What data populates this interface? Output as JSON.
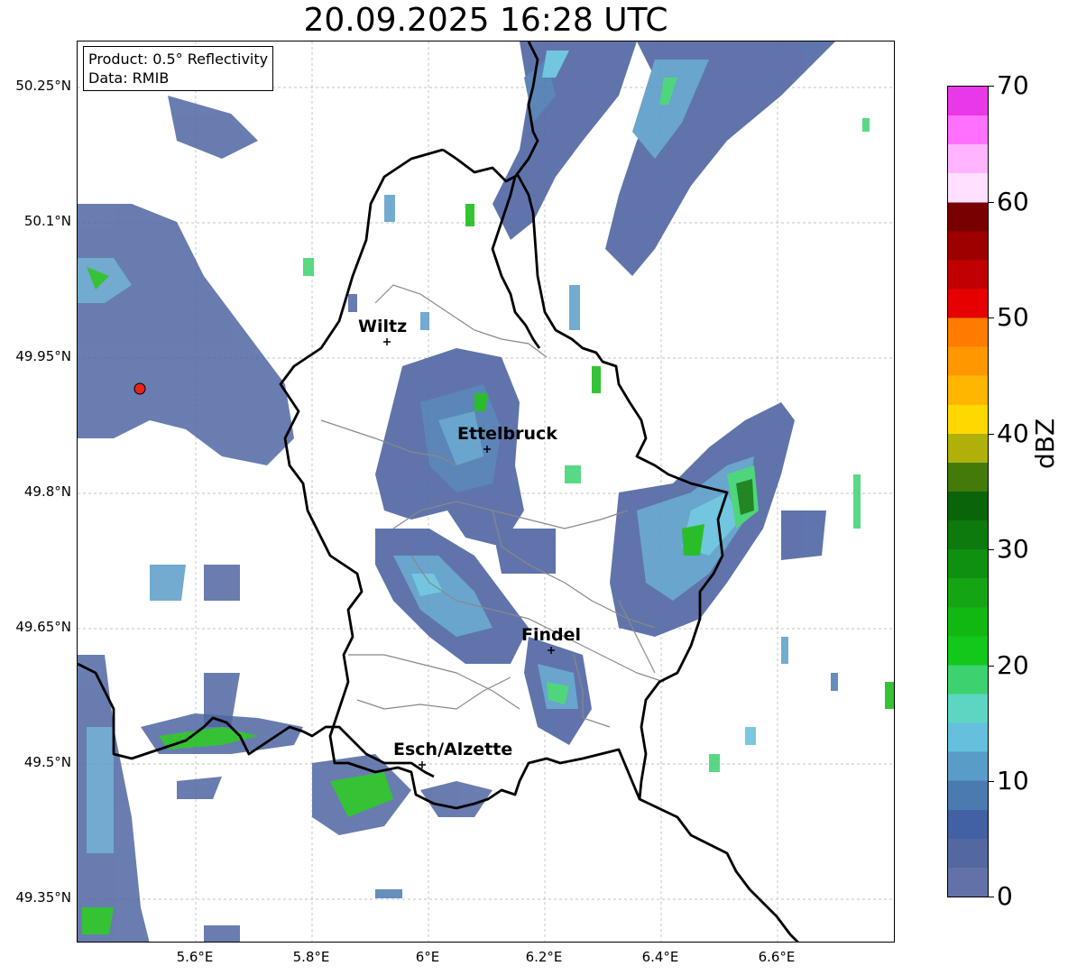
{
  "title": "20.09.2025 16:28 UTC",
  "info_box": {
    "product": "Product: 0.5° Reflectivity",
    "data": "Data: RMIB"
  },
  "latitude_labels": [
    "50.25°N",
    "50.1°N",
    "49.95°N",
    "49.8°N",
    "49.65°N",
    "49.5°N",
    "49.35°N"
  ],
  "longitude_labels": [
    "5.6°E",
    "5.8°E",
    "6°E",
    "6.2°E",
    "6.4°E",
    "6.6°E"
  ],
  "cities": [
    {
      "name": "Wiltz"
    },
    {
      "name": "Ettelbruck"
    },
    {
      "name": "Findel"
    },
    {
      "name": "Esch/Alzette"
    }
  ],
  "radar_site": {
    "color": "#e8231b"
  },
  "colorbar": {
    "unit": "dBZ",
    "ticks": [
      "70",
      "60",
      "50",
      "40",
      "30",
      "20",
      "10",
      "0"
    ],
    "colors": [
      "#6272a8",
      "#52689e",
      "#4260a4",
      "#4a7ab0",
      "#5a9cc8",
      "#64c0dc",
      "#5cd6c2",
      "#3cd270",
      "#12c81a",
      "#12b812",
      "#14a414",
      "#109010",
      "#0c7a0c",
      "#0a640a",
      "#437a0a",
      "#b0b00a",
      "#ffd800",
      "#ffb600",
      "#ff9800",
      "#ff7c00",
      "#e60000",
      "#c00000",
      "#9e0000",
      "#780000",
      "#ffe0ff",
      "#ffb4ff",
      "#ff70ff",
      "#e838e8"
    ]
  },
  "map": {
    "grid": true,
    "country_border_color": "#000000",
    "canton_border_color": "#888888"
  }
}
